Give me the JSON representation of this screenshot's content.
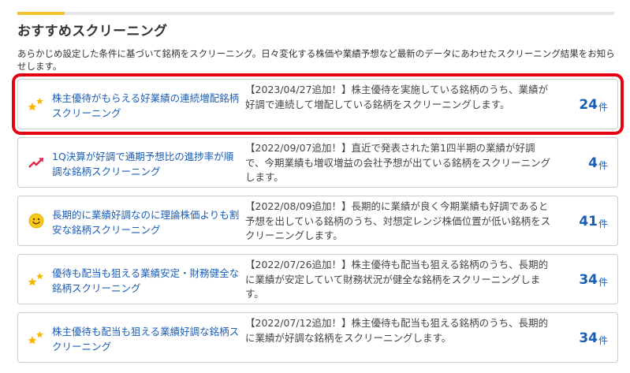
{
  "section": {
    "title": "おすすめスクリーニング",
    "description": "あらかじめ設定した条件に基づいて銘柄をスクリーニング。日々変化する株価や業績予想など最新のデータにあわせたスクリーニング結果をお知らせします。"
  },
  "items": [
    {
      "icon": "stars-icon",
      "name": "株主優待がもらえる好業績の連続増配銘柄スクリーニング",
      "summary": "【2023/04/27追加！】株主優待を実施している銘柄のうち、業績が好調で連続して増配している銘柄をスクリーニングします。",
      "count": "24",
      "unit": "件"
    },
    {
      "icon": "trend-up-icon",
      "name": "1Q決算が好調で通期予想比の進捗率が順調な銘柄スクリーニング",
      "summary": "【2022/09/07追加！】直近で発表された第1四半期の業績が好調で、今期業績も増収増益の会社予想が出ている銘柄をスクリーニングします。",
      "count": "4",
      "unit": "件"
    },
    {
      "icon": "smiley-icon",
      "name": "長期的に業績好調なのに理論株価よりも割安な銘柄スクリーニング",
      "summary": "【2022/08/09追加！】長期的に業績が良く今期業績も好調であると予想を出している銘柄のうち、対想定レンジ株価位置が低い銘柄をスクリーニングします。",
      "count": "41",
      "unit": "件"
    },
    {
      "icon": "stars-icon",
      "name": "優待も配当も狙える業績安定・財務健全な銘柄スクリーニング",
      "summary": "【2022/07/26追加！】株主優待も配当も狙える銘柄のうち、長期的に業績が安定していて財務状況が健全な銘柄をスクリーニングします。",
      "count": "34",
      "unit": "件"
    },
    {
      "icon": "stars-icon",
      "name": "株主優待も配当も狙える業績好調な銘柄スクリーニング",
      "summary": "【2022/07/12追加！】株主優待も配当も狙える銘柄のうち、長期的に業績が好調な銘柄をスクリーニングします。",
      "count": "34",
      "unit": "件"
    }
  ],
  "colors": {
    "accent": "#f0c234",
    "link": "#1a5db5",
    "highlight": "#e60012"
  }
}
